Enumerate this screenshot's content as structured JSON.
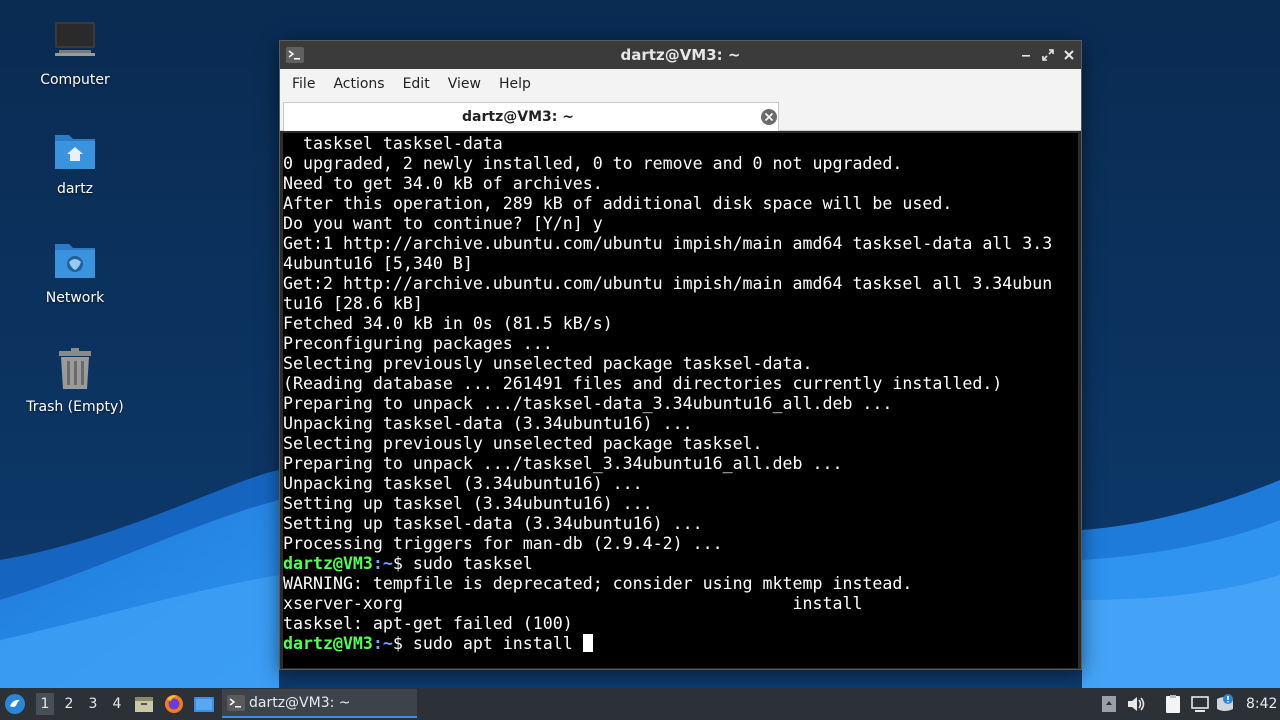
{
  "desktop": {
    "icons": [
      {
        "label": "Computer",
        "icon": "computer-icon"
      },
      {
        "label": "dartz",
        "icon": "home-folder-icon"
      },
      {
        "label": "Network",
        "icon": "network-folder-icon"
      },
      {
        "label": "Trash (Empty)",
        "icon": "trash-icon"
      }
    ]
  },
  "window": {
    "title": "dartz@VM3: ~",
    "menu": [
      "File",
      "Actions",
      "Edit",
      "View",
      "Help"
    ],
    "tab_label": "dartz@VM3: ~"
  },
  "terminal": {
    "lines": [
      "  tasksel tasksel-data",
      "0 upgraded, 2 newly installed, 0 to remove and 0 not upgraded.",
      "Need to get 34.0 kB of archives.",
      "After this operation, 289 kB of additional disk space will be used.",
      "Do you want to continue? [Y/n] y",
      "Get:1 http://archive.ubuntu.com/ubuntu impish/main amd64 tasksel-data all 3.3",
      "4ubuntu16 [5,340 B]",
      "Get:2 http://archive.ubuntu.com/ubuntu impish/main amd64 tasksel all 3.34ubun",
      "tu16 [28.6 kB]",
      "Fetched 34.0 kB in 0s (81.5 kB/s)",
      "Preconfiguring packages ...",
      "Selecting previously unselected package tasksel-data.",
      "(Reading database ... 261491 files and directories currently installed.)",
      "Preparing to unpack .../tasksel-data_3.34ubuntu16_all.deb ...",
      "Unpacking tasksel-data (3.34ubuntu16) ...",
      "Selecting previously unselected package tasksel.",
      "Preparing to unpack .../tasksel_3.34ubuntu16_all.deb ...",
      "Unpacking tasksel (3.34ubuntu16) ...",
      "Setting up tasksel (3.34ubuntu16) ...",
      "Setting up tasksel-data (3.34ubuntu16) ...",
      "Processing triggers for man-db (2.9.4-2) ...",
      {
        "prompt_user": "dartz@VM3",
        "prompt_path": ":~",
        "prompt_sym": "$ ",
        "command": "sudo tasksel"
      },
      "WARNING: tempfile is deprecated; consider using mktemp instead.",
      "xserver-xorg                                       install",
      "tasksel: apt-get failed (100)",
      {
        "prompt_user": "dartz@VM3",
        "prompt_path": ":~",
        "prompt_sym": "$ ",
        "command": "sudo apt install ",
        "cursor": true
      }
    ]
  },
  "taskbar": {
    "workspaces": [
      "1",
      "2",
      "3",
      "4"
    ],
    "active_workspace": "1",
    "launchers": [
      "file-manager-icon",
      "firefox-icon",
      "desktop-icon"
    ],
    "task_label": "dartz@VM3: ~",
    "tray": [
      "screen-icon",
      "volume-icon",
      "clipboard-icon",
      "network-icon",
      "update-notification-icon"
    ],
    "clock": "8:42"
  },
  "colors": {
    "prompt_user": "#55ff55",
    "prompt_path": "#6ea3ff",
    "terminal_bg": "#000000",
    "accent": "#3d8ee6"
  }
}
